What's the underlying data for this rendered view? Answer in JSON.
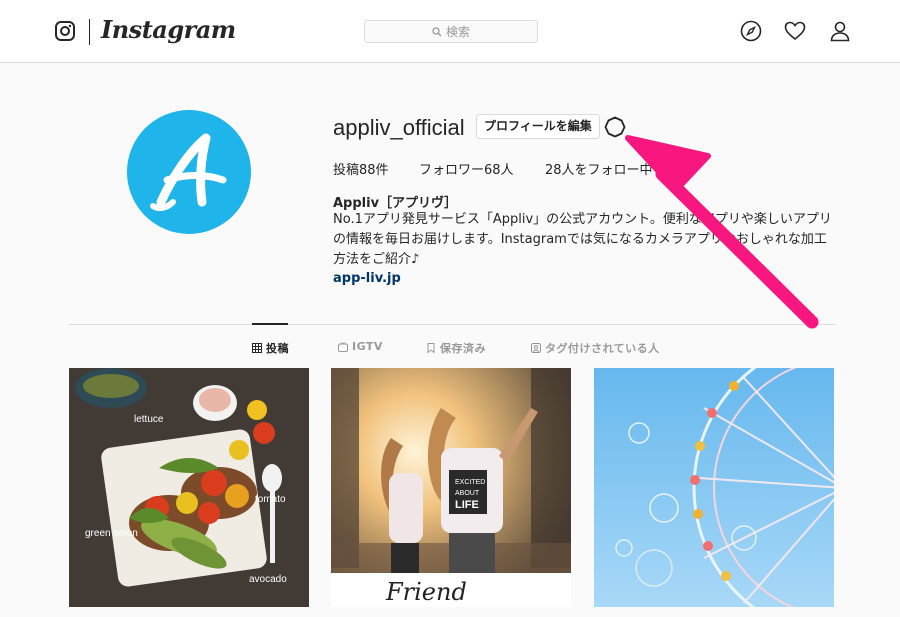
{
  "nav": {
    "app_name": "Instagram",
    "search_placeholder": "検索"
  },
  "profile": {
    "username": "appliv_official",
    "edit_label": "プロフィールを編集",
    "stats": {
      "posts": "投稿88件",
      "followers": "フォロワー68人",
      "following": "28人をフォロー中"
    },
    "bio_name": "Appliv［アプリヴ］",
    "bio_lines": [
      "No.1アプリ発見サービス「Appliv」の公式アカウント。便利なアプリや楽しいアプリ",
      "の情報を毎日お届けします。Instagramでは気になるカメラアプリやおしゃれな加工",
      "方法をご紹介♪"
    ],
    "link": "app-liv.jp"
  },
  "tabs": [
    {
      "label": "投稿",
      "icon": "grid-icon",
      "active": true
    },
    {
      "label": "IGTV",
      "icon": "tv-icon",
      "active": false
    },
    {
      "label": "保存済み",
      "icon": "bookmark-icon",
      "active": false
    },
    {
      "label": "タグ付けされている人",
      "icon": "tag-icon",
      "active": false
    }
  ],
  "posts": [
    {
      "kind": "food",
      "labels": [
        "lettuce",
        "tomato",
        "green onion",
        "avocado"
      ]
    },
    {
      "kind": "girls",
      "caption": "Friend",
      "shirt_text": "EXCITED ABOUT LIFE"
    },
    {
      "kind": "ferris-wheel"
    }
  ],
  "colors": {
    "avatar_bg": "#1fb4ea",
    "link": "#003569",
    "annotation_arrow": "#f7177e"
  }
}
